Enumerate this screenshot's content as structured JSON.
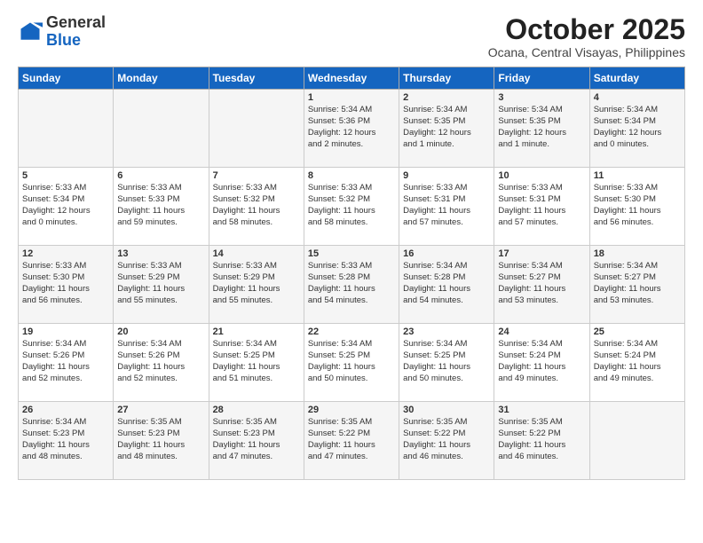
{
  "logo": {
    "general": "General",
    "blue": "Blue"
  },
  "header": {
    "month": "October 2025",
    "location": "Ocana, Central Visayas, Philippines"
  },
  "days_of_week": [
    "Sunday",
    "Monday",
    "Tuesday",
    "Wednesday",
    "Thursday",
    "Friday",
    "Saturday"
  ],
  "weeks": [
    [
      {
        "day": "",
        "content": ""
      },
      {
        "day": "",
        "content": ""
      },
      {
        "day": "",
        "content": ""
      },
      {
        "day": "1",
        "content": "Sunrise: 5:34 AM\nSunset: 5:36 PM\nDaylight: 12 hours\nand 2 minutes."
      },
      {
        "day": "2",
        "content": "Sunrise: 5:34 AM\nSunset: 5:35 PM\nDaylight: 12 hours\nand 1 minute."
      },
      {
        "day": "3",
        "content": "Sunrise: 5:34 AM\nSunset: 5:35 PM\nDaylight: 12 hours\nand 1 minute."
      },
      {
        "day": "4",
        "content": "Sunrise: 5:34 AM\nSunset: 5:34 PM\nDaylight: 12 hours\nand 0 minutes."
      }
    ],
    [
      {
        "day": "5",
        "content": "Sunrise: 5:33 AM\nSunset: 5:34 PM\nDaylight: 12 hours\nand 0 minutes."
      },
      {
        "day": "6",
        "content": "Sunrise: 5:33 AM\nSunset: 5:33 PM\nDaylight: 11 hours\nand 59 minutes."
      },
      {
        "day": "7",
        "content": "Sunrise: 5:33 AM\nSunset: 5:32 PM\nDaylight: 11 hours\nand 58 minutes."
      },
      {
        "day": "8",
        "content": "Sunrise: 5:33 AM\nSunset: 5:32 PM\nDaylight: 11 hours\nand 58 minutes."
      },
      {
        "day": "9",
        "content": "Sunrise: 5:33 AM\nSunset: 5:31 PM\nDaylight: 11 hours\nand 57 minutes."
      },
      {
        "day": "10",
        "content": "Sunrise: 5:33 AM\nSunset: 5:31 PM\nDaylight: 11 hours\nand 57 minutes."
      },
      {
        "day": "11",
        "content": "Sunrise: 5:33 AM\nSunset: 5:30 PM\nDaylight: 11 hours\nand 56 minutes."
      }
    ],
    [
      {
        "day": "12",
        "content": "Sunrise: 5:33 AM\nSunset: 5:30 PM\nDaylight: 11 hours\nand 56 minutes."
      },
      {
        "day": "13",
        "content": "Sunrise: 5:33 AM\nSunset: 5:29 PM\nDaylight: 11 hours\nand 55 minutes."
      },
      {
        "day": "14",
        "content": "Sunrise: 5:33 AM\nSunset: 5:29 PM\nDaylight: 11 hours\nand 55 minutes."
      },
      {
        "day": "15",
        "content": "Sunrise: 5:33 AM\nSunset: 5:28 PM\nDaylight: 11 hours\nand 54 minutes."
      },
      {
        "day": "16",
        "content": "Sunrise: 5:34 AM\nSunset: 5:28 PM\nDaylight: 11 hours\nand 54 minutes."
      },
      {
        "day": "17",
        "content": "Sunrise: 5:34 AM\nSunset: 5:27 PM\nDaylight: 11 hours\nand 53 minutes."
      },
      {
        "day": "18",
        "content": "Sunrise: 5:34 AM\nSunset: 5:27 PM\nDaylight: 11 hours\nand 53 minutes."
      }
    ],
    [
      {
        "day": "19",
        "content": "Sunrise: 5:34 AM\nSunset: 5:26 PM\nDaylight: 11 hours\nand 52 minutes."
      },
      {
        "day": "20",
        "content": "Sunrise: 5:34 AM\nSunset: 5:26 PM\nDaylight: 11 hours\nand 52 minutes."
      },
      {
        "day": "21",
        "content": "Sunrise: 5:34 AM\nSunset: 5:25 PM\nDaylight: 11 hours\nand 51 minutes."
      },
      {
        "day": "22",
        "content": "Sunrise: 5:34 AM\nSunset: 5:25 PM\nDaylight: 11 hours\nand 50 minutes."
      },
      {
        "day": "23",
        "content": "Sunrise: 5:34 AM\nSunset: 5:25 PM\nDaylight: 11 hours\nand 50 minutes."
      },
      {
        "day": "24",
        "content": "Sunrise: 5:34 AM\nSunset: 5:24 PM\nDaylight: 11 hours\nand 49 minutes."
      },
      {
        "day": "25",
        "content": "Sunrise: 5:34 AM\nSunset: 5:24 PM\nDaylight: 11 hours\nand 49 minutes."
      }
    ],
    [
      {
        "day": "26",
        "content": "Sunrise: 5:34 AM\nSunset: 5:23 PM\nDaylight: 11 hours\nand 48 minutes."
      },
      {
        "day": "27",
        "content": "Sunrise: 5:35 AM\nSunset: 5:23 PM\nDaylight: 11 hours\nand 48 minutes."
      },
      {
        "day": "28",
        "content": "Sunrise: 5:35 AM\nSunset: 5:23 PM\nDaylight: 11 hours\nand 47 minutes."
      },
      {
        "day": "29",
        "content": "Sunrise: 5:35 AM\nSunset: 5:22 PM\nDaylight: 11 hours\nand 47 minutes."
      },
      {
        "day": "30",
        "content": "Sunrise: 5:35 AM\nSunset: 5:22 PM\nDaylight: 11 hours\nand 46 minutes."
      },
      {
        "day": "31",
        "content": "Sunrise: 5:35 AM\nSunset: 5:22 PM\nDaylight: 11 hours\nand 46 minutes."
      },
      {
        "day": "",
        "content": ""
      }
    ]
  ]
}
